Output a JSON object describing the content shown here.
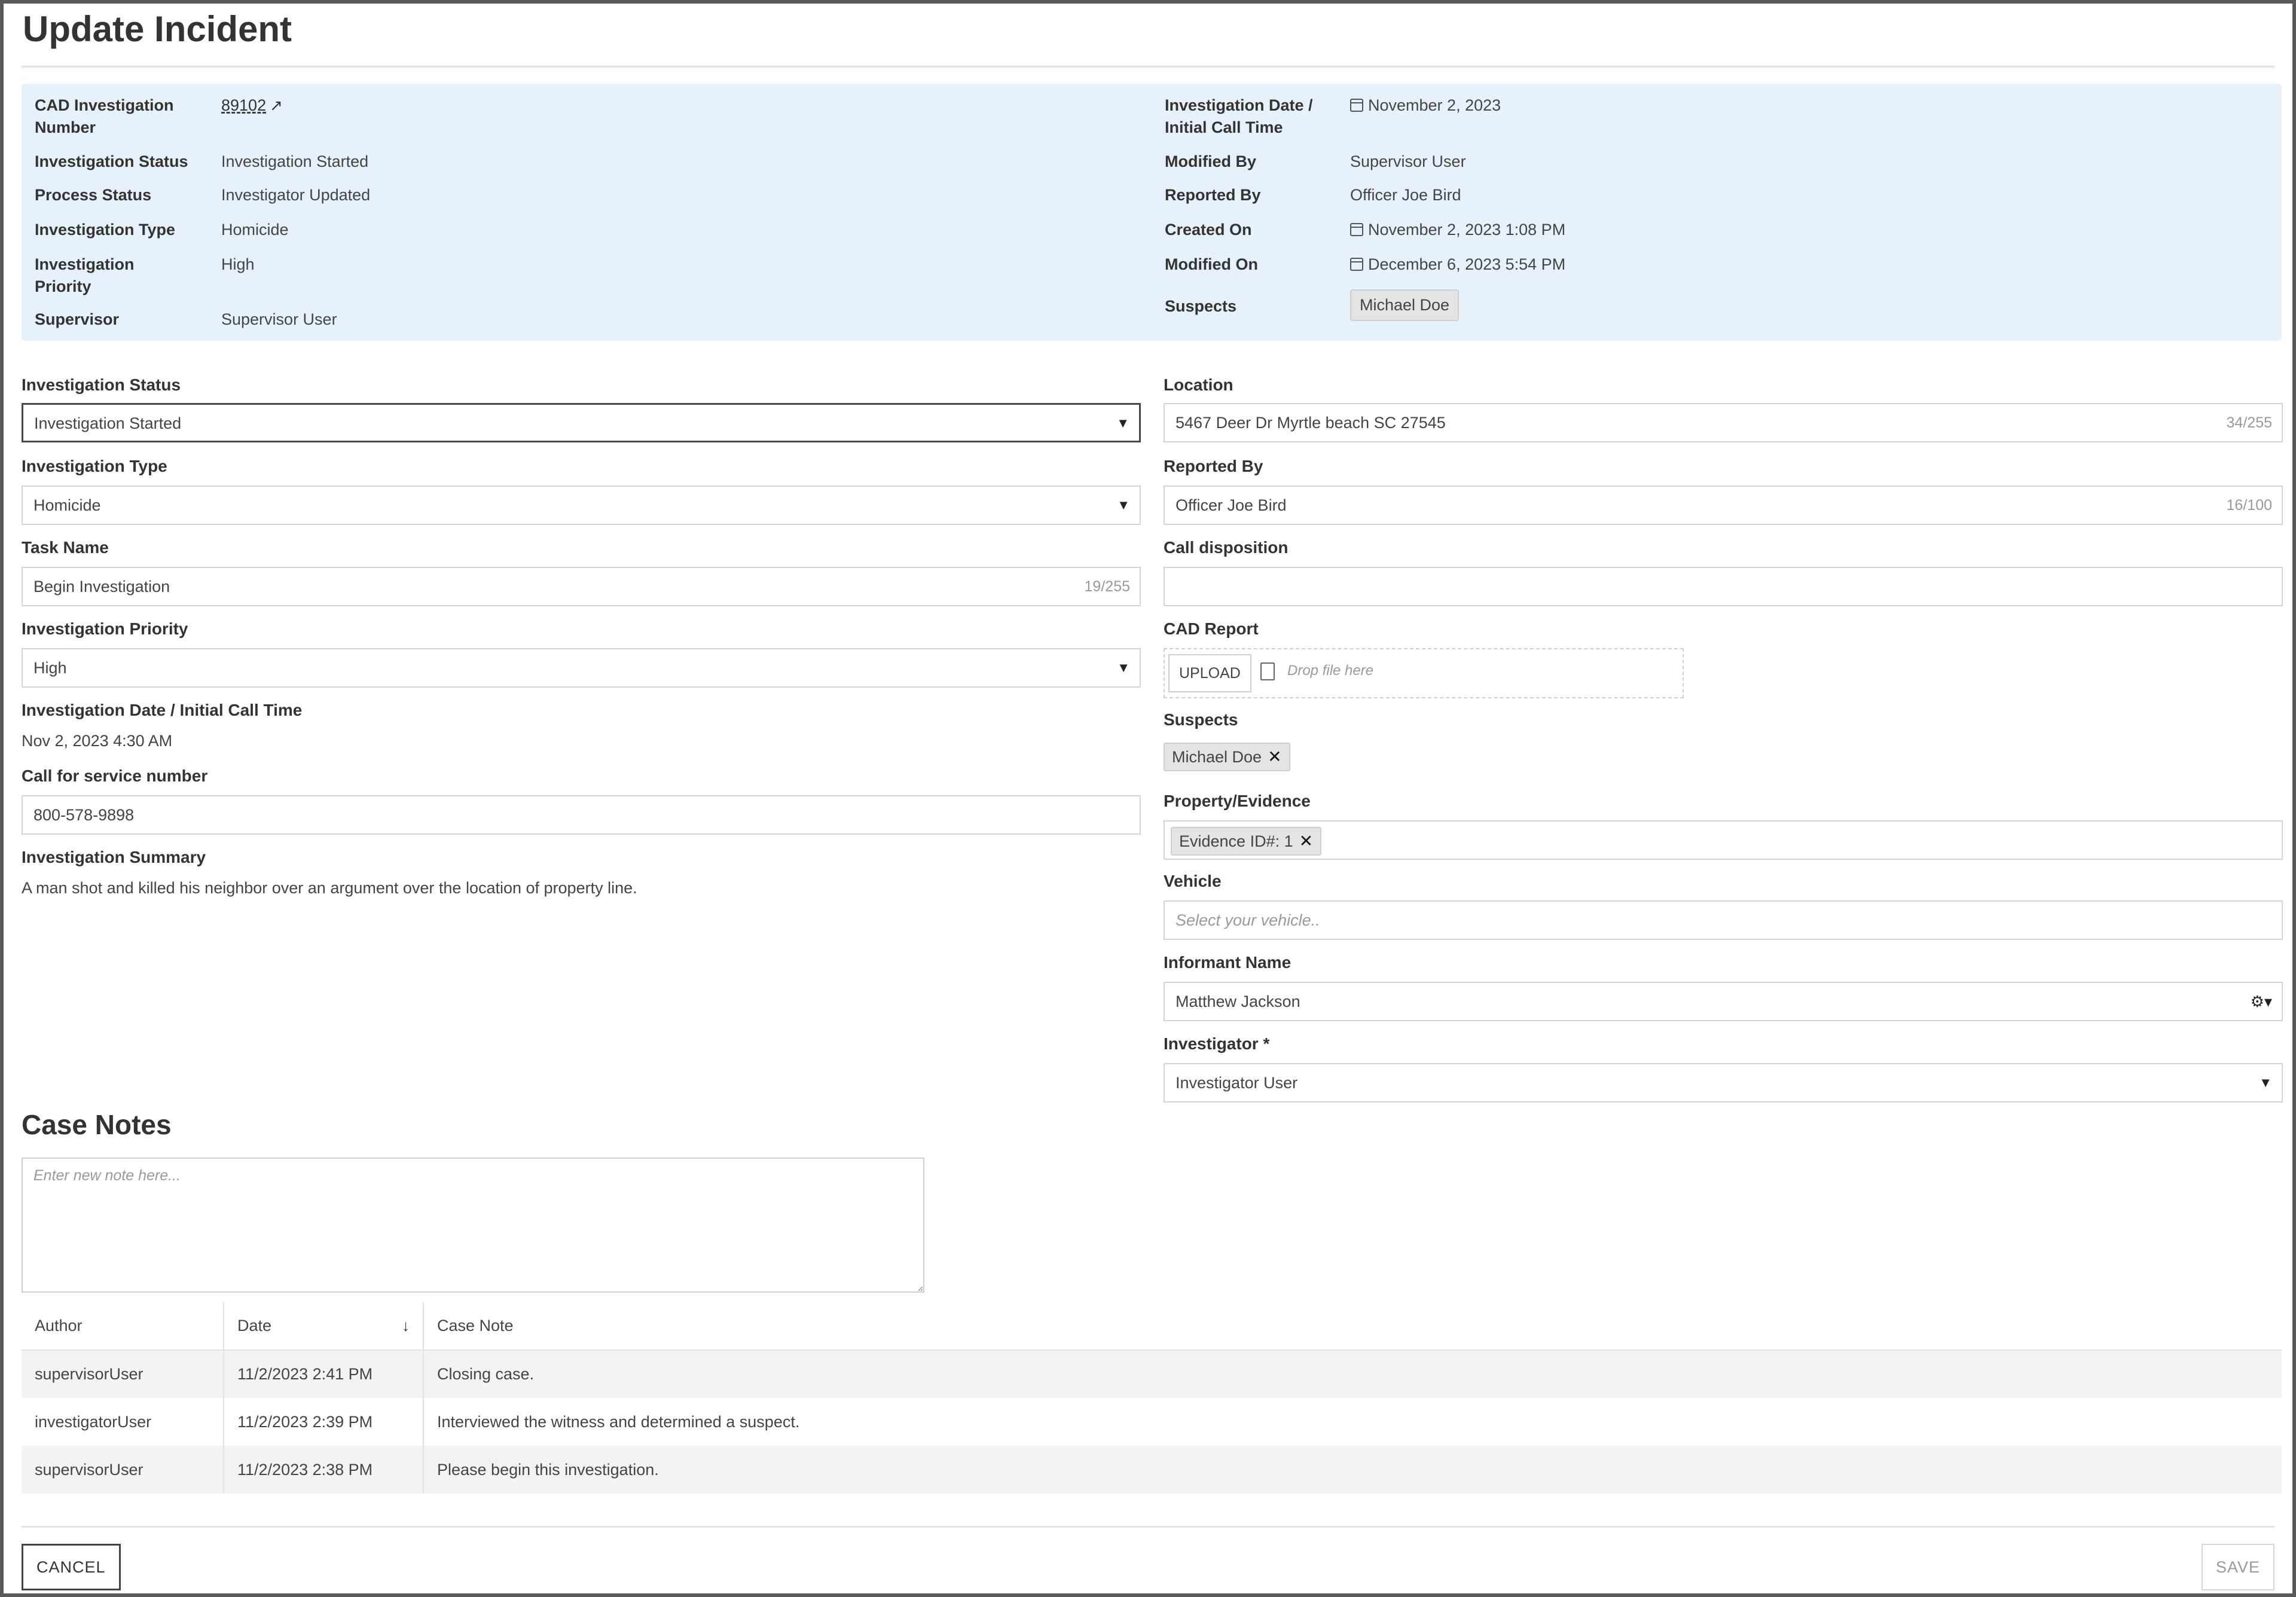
{
  "page": {
    "title": "Update Incident"
  },
  "summary": {
    "cad_label": "CAD Investigation Number",
    "cad_value": "89102",
    "inv_status_label": "Investigation Status",
    "inv_status_value": "Investigation Started",
    "process_status_label": "Process Status",
    "process_status_value": "Investigator Updated",
    "inv_type_label": "Investigation Type",
    "inv_type_value": "Homicide",
    "priority_label": "Investigation Priority",
    "priority_value": "High",
    "supervisor_label": "Supervisor",
    "supervisor_value": "Supervisor User",
    "inv_date_label": "Investigation Date / Initial Call Time",
    "inv_date_value": "November 2, 2023",
    "modified_by_label": "Modified By",
    "modified_by_value": "Supervisor User",
    "reported_by_label": "Reported By",
    "reported_by_value": "Officer Joe Bird",
    "created_on_label": "Created On",
    "created_on_value": "November 2, 2023 1:08 PM",
    "modified_on_label": "Modified On",
    "modified_on_value": "December 6, 2023 5:54 PM",
    "suspects_label": "Suspects",
    "suspects_value": "Michael Doe"
  },
  "form": {
    "inv_status": {
      "label": "Investigation Status",
      "value": "Investigation Started"
    },
    "inv_type": {
      "label": "Investigation Type",
      "value": "Homicide"
    },
    "task_name": {
      "label": "Task Name",
      "value": "Begin Investigation",
      "counter": "19/255"
    },
    "priority": {
      "label": "Investigation Priority",
      "value": "High"
    },
    "inv_date": {
      "label": "Investigation Date / Initial Call Time",
      "value": "Nov 2, 2023 4:30 AM"
    },
    "call_number": {
      "label": "Call for service number",
      "value": "800-578-9898"
    },
    "summary": {
      "label": "Investigation Summary",
      "value": "A man shot and killed his neighbor over an argument over the location of property line."
    },
    "location": {
      "label": "Location",
      "value": "5467 Deer Dr Myrtle beach SC 27545",
      "counter": "34/255"
    },
    "reported_by": {
      "label": "Reported By",
      "value": "Officer Joe Bird",
      "counter": "16/100"
    },
    "call_disposition": {
      "label": "Call disposition",
      "value": ""
    },
    "cad_report": {
      "label": "CAD Report",
      "upload_label": "UPLOAD",
      "drop_text": "Drop file here"
    },
    "suspects": {
      "label": "Suspects",
      "tag": "Michael Doe"
    },
    "evidence": {
      "label": "Property/Evidence",
      "tag": "Evidence ID#: 1"
    },
    "vehicle": {
      "label": "Vehicle",
      "placeholder": "Select your vehicle.."
    },
    "informant": {
      "label": "Informant Name",
      "value": "Matthew Jackson"
    },
    "investigator": {
      "label": "Investigator *",
      "value": "Investigator User"
    }
  },
  "case_notes": {
    "title": "Case Notes",
    "placeholder": "Enter new note here...",
    "columns": [
      "Author",
      "Date",
      "Case Note"
    ],
    "rows": [
      {
        "author": "supervisorUser",
        "date": "11/2/2023 2:41 PM",
        "note": "Closing case."
      },
      {
        "author": "investigatorUser",
        "date": "11/2/2023 2:39 PM",
        "note": "Interviewed the witness and determined a suspect."
      },
      {
        "author": "supervisorUser",
        "date": "11/2/2023 2:38 PM",
        "note": "Please begin this investigation."
      }
    ]
  },
  "buttons": {
    "cancel": "CANCEL",
    "save": "SAVE"
  },
  "icons": {
    "external_link": "external-link-icon",
    "calendar": "calendar-icon",
    "dropdown": "chevron-down-icon",
    "remove": "close-icon",
    "sort": "sort-descending-icon",
    "settings": "gear-icon",
    "file": "file-icon"
  }
}
